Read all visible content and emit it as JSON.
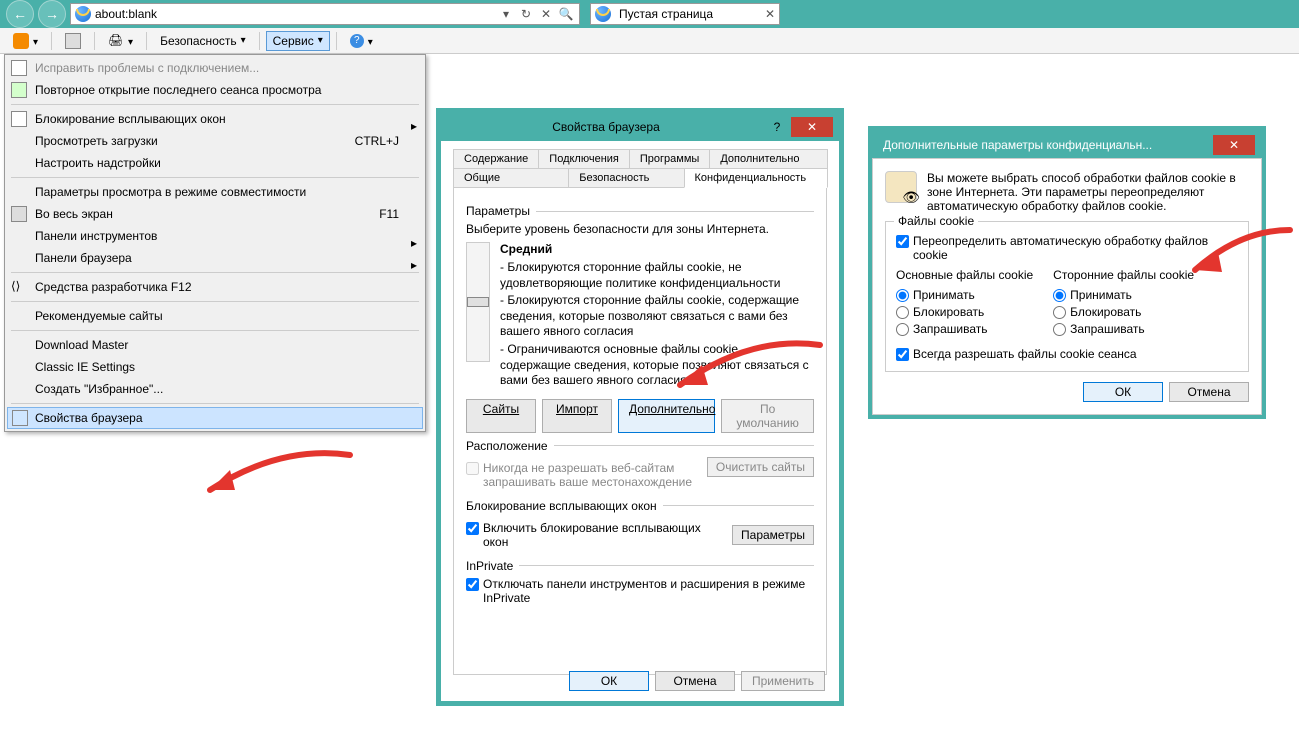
{
  "address_bar": {
    "url": "about:blank"
  },
  "tab": {
    "title": "Пустая страница"
  },
  "toolbar": {
    "security": "Безопасность",
    "service": "Сервис"
  },
  "menu": {
    "fix_conn": "Исправить проблемы с подключением...",
    "reopen": "Повторное открытие последнего сеанса просмотра",
    "popup": "Блокирование всплывающих окон",
    "downloads": "Просмотреть загрузки",
    "downloads_shortcut": "CTRL+J",
    "addons": "Настроить надстройки",
    "compat": "Параметры просмотра в режиме совместимости",
    "fullscreen": "Во весь экран",
    "fullscreen_shortcut": "F11",
    "toolpanels": "Панели инструментов",
    "browserpanels": "Панели браузера",
    "devtools": "Средства разработчика F12",
    "recommended": "Рекомендуемые сайты",
    "dm": "Download Master",
    "classic": "Classic IE Settings",
    "favorites": "Создать \"Избранное\"...",
    "props": "Свойства браузера"
  },
  "props": {
    "title": "Свойства браузера",
    "tabs": {
      "content": "Содержание",
      "connections": "Подключения",
      "programs": "Программы",
      "advanced": "Дополнительно",
      "general": "Общие",
      "security": "Безопасность",
      "privacy": "Конфиденциальность"
    },
    "params_label": "Параметры",
    "select_level": "Выберите уровень безопасности для зоны Интернета.",
    "level_name": "Средний",
    "bullet1": "- Блокируются сторонние файлы cookie, не удовлетворяющие политике конфиденциальности",
    "bullet2": "- Блокируются сторонние файлы cookie, содержащие сведения, которые позволяют связаться с вами без вашего явного согласия",
    "bullet3": "- Ограничиваются основные файлы cookie, содержащие сведения, которые позволяют связаться с вами без вашего явного согласия",
    "btn_sites": "Сайты",
    "btn_import": "Импорт",
    "btn_advanced": "Дополнительно",
    "btn_default": "По умолчанию",
    "location_label": "Расположение",
    "location_check": "Никогда не разрешать веб-сайтам запрашивать ваше местонахождение",
    "btn_clearsites": "Очистить сайты",
    "popup_label": "Блокирование всплывающих окон",
    "popup_check": "Включить блокирование всплывающих окон",
    "btn_params": "Параметры",
    "inprivate_label": "InPrivate",
    "inprivate_check": "Отключать панели инструментов и расширения в режиме InPrivate",
    "ok": "ОК",
    "cancel": "Отмена",
    "apply": "Применить"
  },
  "adv": {
    "title": "Дополнительные параметры конфиденциальн...",
    "intro": "Вы можете выбрать способ обработки файлов cookie в зоне Интернета. Эти параметры переопределяют автоматическую обработку файлов cookie.",
    "group": "Файлы cookie",
    "override": "Переопределить автоматическую обработку файлов cookie",
    "col1": "Основные файлы cookie",
    "col2": "Сторонние файлы cookie",
    "accept": "Принимать",
    "block": "Блокировать",
    "ask": "Запрашивать",
    "session": "Всегда разрешать файлы cookie сеанса",
    "ok": "ОК",
    "cancel": "Отмена"
  }
}
